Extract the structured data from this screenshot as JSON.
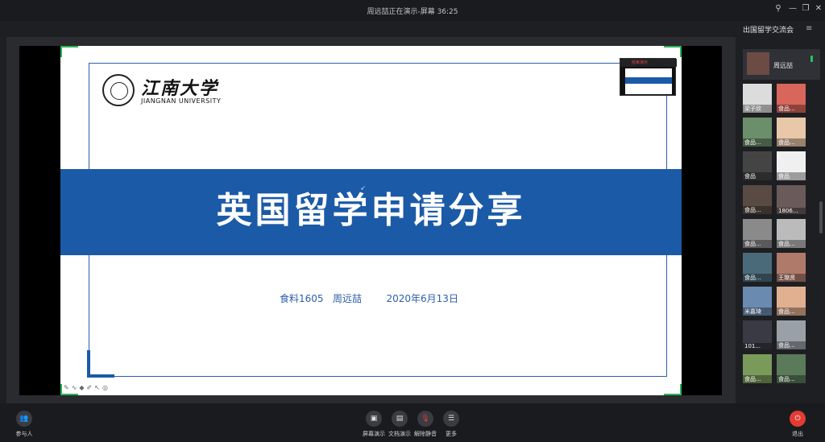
{
  "titlebar": {
    "title": "周远喆正在演示-屏幕 36:25",
    "pin_icon": "pin-icon",
    "restore_icon": "restore-icon",
    "close_icon": "close-icon"
  },
  "slide": {
    "logo_cn": "江南大学",
    "logo_en": "JIANGNAN UNIVERSITY",
    "title": "英国留学申请分享",
    "subtitle": "食料1605   周远喆        2020年6月13日",
    "band_color": "#1b5aa6"
  },
  "mini_preview": {
    "rec_label": "结束演示"
  },
  "sidebar": {
    "title": "出国留学交流会",
    "me": {
      "name": "周远喆"
    },
    "participants": [
      {
        "name": "梁子欣",
        "color": "#dcdcdc"
      },
      {
        "name": "食品...",
        "color": "#d9665a"
      },
      {
        "name": "食品...",
        "color": "#6b8f6a"
      },
      {
        "name": "食品...",
        "color": "#e8c8a8"
      },
      {
        "name": "食品",
        "color": "#444"
      },
      {
        "name": "食品",
        "color": "#f0f0f0"
      },
      {
        "name": "食品...",
        "color": "#5a4a44"
      },
      {
        "name": "1806...",
        "color": "#6a5a5a"
      },
      {
        "name": "食品...",
        "color": "#8a8a8a"
      },
      {
        "name": "食品...",
        "color": "#bbb"
      },
      {
        "name": "食品...",
        "color": "#4a6a7a"
      },
      {
        "name": "王璐贤",
        "color": "#b07a6a"
      },
      {
        "name": "米嘉琦",
        "color": "#6a8ab0"
      },
      {
        "name": "食品...",
        "color": "#e0b090"
      },
      {
        "name": "101...",
        "color": "#3a3a44"
      },
      {
        "name": "食品...",
        "color": "#9aa0a8"
      },
      {
        "name": "食品...",
        "color": "#7a9a5a"
      },
      {
        "name": "食品...",
        "color": "#5a7a5a"
      }
    ]
  },
  "toolbar": {
    "participants": "参与人",
    "screen_share": "屏幕演示",
    "doc_share": "文档演示",
    "unmute": "解除静音",
    "more": "更多",
    "exit": "退出"
  }
}
